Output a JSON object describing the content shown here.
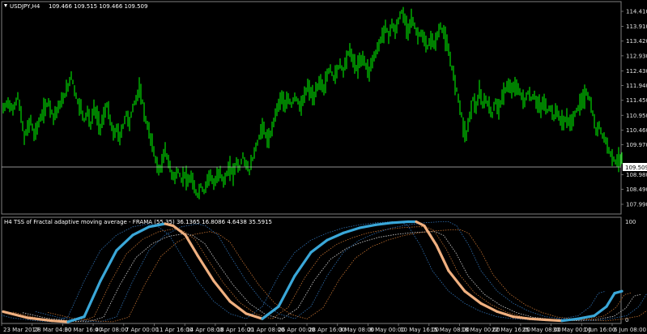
{
  "main_panel": {
    "symbol_tf": "USDJPY,H4",
    "ohlc": "109.466 109.515 109.466 109.509",
    "price_labels": [
      "114.410",
      "113.910",
      "113.420",
      "112.930",
      "112.430",
      "111.940",
      "111.450",
      "110.950",
      "110.460",
      "109.970",
      "108.980",
      "108.490",
      "107.990"
    ],
    "current_price_label": "109.509",
    "colors": {
      "bars": "#00ff00",
      "grid": "#808080",
      "background": "#000000",
      "price_line": "#c0c0c0"
    }
  },
  "indicator_panel": {
    "title": "H4 TSS of Fractal adaptive moving average - FRAMA (55,35) 36.1365 16.8086 4.6438 35.5915",
    "scale_top": "100",
    "scale_bottom": "0",
    "colors": {
      "main_up": "#3aa7d8",
      "main_down": "#f0b080",
      "aux_blue": "#2f6fb0",
      "aux_orange": "#c07030",
      "aux_white": "#d0d0d0"
    }
  },
  "time_axis": [
    "23 Mar 2017",
    "28 Mar 04:00",
    "30 Mar 16:00",
    "4 Apr 08:00",
    "7 Apr 00:00",
    "11 Apr 16:00",
    "14 Apr 08:00",
    "18 Apr 16:00",
    "21 Apr 08:00",
    "26 Apr 00:00",
    "28 Apr 16:00",
    "3 May 08:00",
    "8 May 00:00",
    "10 May 16:00",
    "15 May 08:00",
    "18 May 00:00",
    "22 May 16:00",
    "25 May 08:00",
    "30 May 00:00",
    "1 Jun 16:00",
    "6 Jun 08:00"
  ],
  "chart_data": {
    "type": "line",
    "close_path": [
      [
        0,
        111.15
      ],
      [
        6,
        111.4
      ],
      [
        12,
        111.1
      ],
      [
        18,
        111.6
      ],
      [
        22,
        110.95
      ],
      [
        26,
        110.2
      ],
      [
        30,
        110.5
      ],
      [
        34,
        110.8
      ],
      [
        38,
        110.3
      ],
      [
        44,
        110.7
      ],
      [
        50,
        111.1
      ],
      [
        56,
        111.4
      ],
      [
        62,
        110.9
      ],
      [
        68,
        111.2
      ],
      [
        74,
        111.5
      ],
      [
        80,
        111.9
      ],
      [
        84,
        112.3
      ],
      [
        88,
        111.8
      ],
      [
        92,
        111.4
      ],
      [
        96,
        111.2
      ],
      [
        100,
        110.8
      ],
      [
        104,
        111.1
      ],
      [
        108,
        110.6
      ],
      [
        112,
        111.2
      ],
      [
        116,
        110.9
      ],
      [
        120,
        110.55
      ],
      [
        124,
        110.9
      ],
      [
        128,
        111.3
      ],
      [
        132,
        110.8
      ],
      [
        136,
        110.3
      ],
      [
        140,
        110.5
      ],
      [
        144,
        110.2
      ],
      [
        148,
        110.6
      ],
      [
        152,
        111.0
      ],
      [
        156,
        110.7
      ],
      [
        160,
        111.2
      ],
      [
        164,
        111.5
      ],
      [
        168,
        111.8
      ],
      [
        172,
        111.4
      ],
      [
        176,
        110.8
      ],
      [
        180,
        110.4
      ],
      [
        184,
        110.0
      ],
      [
        188,
        109.5
      ],
      [
        192,
        109.1
      ],
      [
        196,
        109.3
      ],
      [
        200,
        109.8
      ],
      [
        204,
        109.4
      ],
      [
        208,
        109.0
      ],
      [
        212,
        108.9
      ],
      [
        216,
        109.1
      ],
      [
        220,
        108.8
      ],
      [
        224,
        109.0
      ],
      [
        228,
        108.7
      ],
      [
        232,
        108.9
      ],
      [
        236,
        108.5
      ],
      [
        240,
        108.3
      ],
      [
        244,
        108.6
      ],
      [
        248,
        108.4
      ],
      [
        252,
        108.8
      ],
      [
        256,
        109.0
      ],
      [
        260,
        108.6
      ],
      [
        264,
        108.9
      ],
      [
        268,
        109.1
      ],
      [
        272,
        108.7
      ],
      [
        276,
        109.0
      ],
      [
        280,
        109.2
      ],
      [
        284,
        109.0
      ],
      [
        288,
        109.4
      ],
      [
        292,
        109.2
      ],
      [
        296,
        109.6
      ],
      [
        300,
        109.3
      ],
      [
        304,
        109.1
      ],
      [
        308,
        109.5
      ],
      [
        312,
        109.9
      ],
      [
        316,
        110.2
      ],
      [
        320,
        110.6
      ],
      [
        324,
        110.3
      ],
      [
        328,
        110.1
      ],
      [
        332,
        110.5
      ],
      [
        336,
        111.0
      ],
      [
        340,
        111.3
      ],
      [
        344,
        111.6
      ],
      [
        348,
        111.2
      ],
      [
        352,
        111.5
      ],
      [
        356,
        111.3
      ],
      [
        360,
        111.6
      ],
      [
        364,
        111.4
      ],
      [
        368,
        111.2
      ],
      [
        372,
        111.6
      ],
      [
        376,
        111.9
      ],
      [
        380,
        111.7
      ],
      [
        384,
        111.5
      ],
      [
        388,
        111.9
      ],
      [
        392,
        112.1
      ],
      [
        396,
        111.8
      ],
      [
        400,
        112.3
      ],
      [
        404,
        112.5
      ],
      [
        408,
        112.2
      ],
      [
        412,
        112.4
      ],
      [
        416,
        112.7
      ],
      [
        420,
        112.4
      ],
      [
        424,
        112.9
      ],
      [
        428,
        113.1
      ],
      [
        432,
        112.8
      ],
      [
        436,
        112.5
      ],
      [
        440,
        112.7
      ],
      [
        444,
        112.9
      ],
      [
        448,
        112.6
      ],
      [
        452,
        112.4
      ],
      [
        456,
        112.8
      ],
      [
        460,
        113.0
      ],
      [
        464,
        113.3
      ],
      [
        468,
        113.6
      ],
      [
        472,
        113.9
      ],
      [
        476,
        113.6
      ],
      [
        480,
        114.0
      ],
      [
        484,
        113.7
      ],
      [
        488,
        114.1
      ],
      [
        492,
        114.4
      ],
      [
        496,
        114.1
      ],
      [
        500,
        113.8
      ],
      [
        504,
        114.2
      ],
      [
        508,
        113.9
      ],
      [
        512,
        113.6
      ],
      [
        516,
        113.7
      ],
      [
        520,
        113.4
      ],
      [
        524,
        113.2
      ],
      [
        528,
        113.5
      ],
      [
        532,
        113.3
      ],
      [
        536,
        113.6
      ],
      [
        540,
        113.9
      ],
      [
        544,
        113.7
      ],
      [
        548,
        113.3
      ],
      [
        552,
        112.8
      ],
      [
        556,
        112.3
      ],
      [
        560,
        111.8
      ],
      [
        564,
        111.3
      ],
      [
        568,
        110.6
      ],
      [
        572,
        110.3
      ],
      [
        576,
        110.9
      ],
      [
        580,
        111.5
      ],
      [
        584,
        111.2
      ],
      [
        588,
        111.7
      ],
      [
        592,
        111.3
      ],
      [
        596,
        111.5
      ],
      [
        600,
        111.2
      ],
      [
        604,
        111.0
      ],
      [
        608,
        111.4
      ],
      [
        612,
        111.2
      ],
      [
        616,
        111.5
      ],
      [
        620,
        111.8
      ],
      [
        624,
        112.0
      ],
      [
        628,
        111.7
      ],
      [
        632,
        112.0
      ],
      [
        636,
        111.8
      ],
      [
        640,
        111.6
      ],
      [
        644,
        111.4
      ],
      [
        648,
        111.7
      ],
      [
        652,
        111.5
      ],
      [
        656,
        111.6
      ],
      [
        660,
        111.3
      ],
      [
        664,
        111.2
      ],
      [
        668,
        111.4
      ],
      [
        672,
        111.1
      ],
      [
        676,
        111.2
      ],
      [
        680,
        110.9
      ],
      [
        684,
        111.1
      ],
      [
        688,
        110.8
      ],
      [
        692,
        110.7
      ],
      [
        696,
        110.9
      ],
      [
        700,
        110.6
      ],
      [
        704,
        110.9
      ],
      [
        708,
        111.1
      ],
      [
        712,
        111.3
      ],
      [
        716,
        111.5
      ],
      [
        720,
        111.7
      ],
      [
        724,
        111.5
      ],
      [
        728,
        111.0
      ],
      [
        732,
        110.4
      ],
      [
        736,
        110.6
      ],
      [
        740,
        110.3
      ],
      [
        744,
        110.1
      ],
      [
        748,
        109.8
      ],
      [
        752,
        109.6
      ],
      [
        756,
        109.4
      ],
      [
        760,
        109.5
      ],
      [
        764,
        109.509
      ]
    ],
    "tss_main": [
      [
        0,
        10
      ],
      [
        30,
        4
      ],
      [
        60,
        1
      ],
      [
        80,
        0
      ],
      [
        100,
        5
      ],
      [
        120,
        40
      ],
      [
        140,
        70
      ],
      [
        160,
        85
      ],
      [
        180,
        93
      ],
      [
        200,
        96
      ],
      [
        210,
        94
      ],
      [
        225,
        85
      ],
      [
        240,
        65
      ],
      [
        260,
        40
      ],
      [
        280,
        20
      ],
      [
        300,
        8
      ],
      [
        320,
        3
      ],
      [
        340,
        15
      ],
      [
        360,
        45
      ],
      [
        380,
        68
      ],
      [
        400,
        80
      ],
      [
        420,
        87
      ],
      [
        440,
        92
      ],
      [
        460,
        95
      ],
      [
        480,
        97
      ],
      [
        500,
        98
      ],
      [
        510,
        98
      ],
      [
        520,
        94
      ],
      [
        535,
        75
      ],
      [
        550,
        50
      ],
      [
        570,
        30
      ],
      [
        590,
        18
      ],
      [
        610,
        10
      ],
      [
        630,
        5
      ],
      [
        650,
        3
      ],
      [
        670,
        2
      ],
      [
        690,
        1
      ],
      [
        710,
        3
      ],
      [
        730,
        6
      ],
      [
        745,
        15
      ],
      [
        755,
        28
      ],
      [
        764,
        30
      ]
    ]
  }
}
